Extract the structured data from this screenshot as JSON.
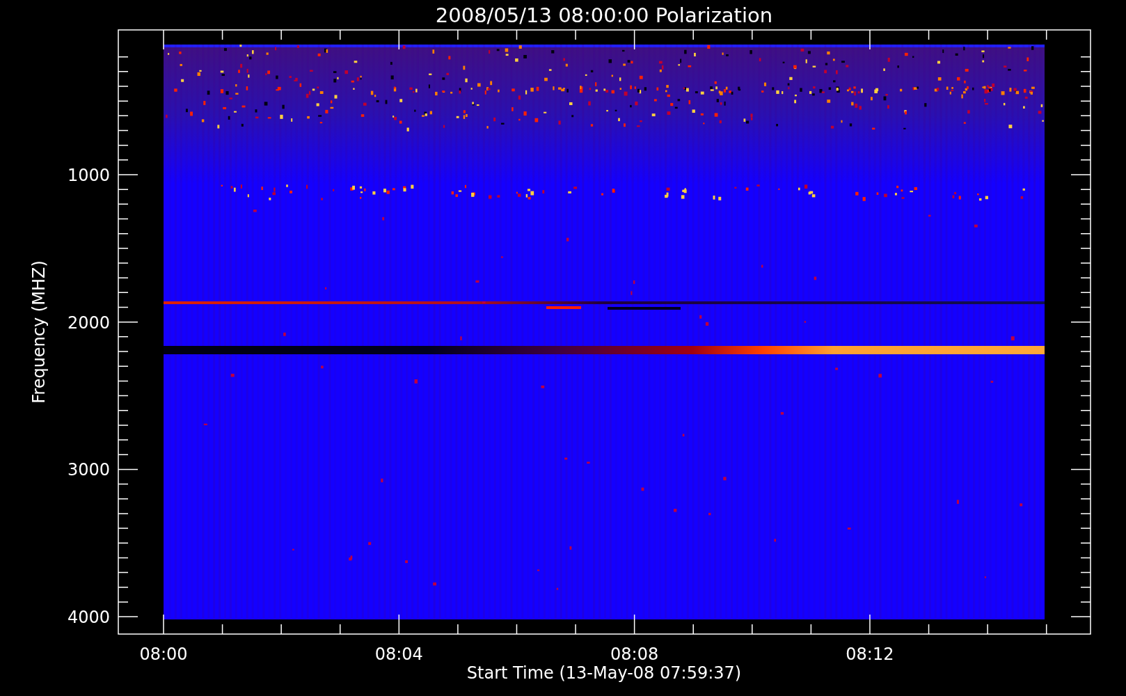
{
  "plot": {
    "kind": "spectrogram",
    "title": "2008/05/13 08:00:00 Polarization",
    "ylabel": "Frequency (MHZ)",
    "xlabel": "Start Time (13-May-08 07:59:37)",
    "yticks": [
      "1000",
      "2000",
      "3000",
      "4000"
    ],
    "xticks": [
      "08:00",
      "08:04",
      "08:08",
      "08:12"
    ]
  }
}
